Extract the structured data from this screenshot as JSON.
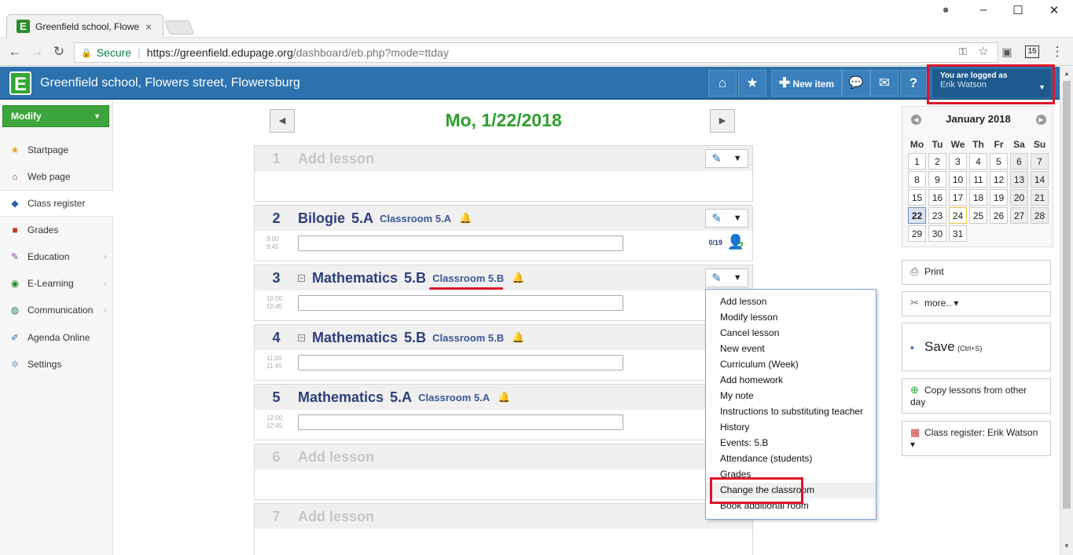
{
  "browser": {
    "tab_title": "Greenfield school, Flower",
    "tab_close": "×",
    "secure_label": "Secure",
    "url_main": "https://greenfield.edupage.org",
    "url_path": "/dashboard/eb.php?mode=ttday"
  },
  "header": {
    "school_name": "Greenfield school, Flowers street, Flowersburg",
    "new_item_label": "New item",
    "help_label": "?",
    "logged_as_label": "You are logged as",
    "user_name": "Erik Watson"
  },
  "sidebar": {
    "modify_label": "Modify",
    "items": [
      {
        "label": "Startpage"
      },
      {
        "label": "Web page"
      },
      {
        "label": "Class register"
      },
      {
        "label": "Grades"
      },
      {
        "label": "Education"
      },
      {
        "label": "E-Learning"
      },
      {
        "label": "Communication"
      },
      {
        "label": "Agenda Online"
      },
      {
        "label": "Settings"
      }
    ]
  },
  "day": {
    "title": "Mo, 1/22/2018"
  },
  "lessons": [
    {
      "num": "1",
      "subject": "Add lesson"
    },
    {
      "num": "2",
      "subject": "Bilogie",
      "class": "5.A",
      "room": "Classroom 5.A",
      "start": "9:00",
      "end": "9:45",
      "attendance": "0/19"
    },
    {
      "num": "3",
      "subject": "Mathematics",
      "class": "5.B",
      "room": "Classroom 5.B",
      "start": "10:00",
      "end": "10:45"
    },
    {
      "num": "4",
      "subject": "Mathematics",
      "class": "5.B",
      "room": "Classroom 5.B",
      "start": "11:00",
      "end": "11:45"
    },
    {
      "num": "5",
      "subject": "Mathematics",
      "class": "5.A",
      "room": "Classroom 5.A",
      "start": "12:00",
      "end": "12:45"
    },
    {
      "num": "6",
      "subject": "Add lesson"
    },
    {
      "num": "7",
      "subject": "Add lesson"
    }
  ],
  "menu": {
    "items": [
      "Add lesson",
      "Modify lesson",
      "Cancel lesson",
      "New event",
      "Curriculum (Week)",
      "Add homework",
      "My note",
      "Instructions to substituting teacher",
      "History",
      "Events: 5.B",
      "Attendance (students)",
      "Grades",
      "Change the classroom",
      "Book additional room"
    ]
  },
  "calendar": {
    "title": "January 2018",
    "weekdays": [
      "Mo",
      "Tu",
      "We",
      "Th",
      "Fr",
      "Sa",
      "Su"
    ],
    "weeks": [
      [
        "1",
        "2",
        "3",
        "4",
        "5",
        "6",
        "7"
      ],
      [
        "8",
        "9",
        "10",
        "11",
        "12",
        "13",
        "14"
      ],
      [
        "15",
        "16",
        "17",
        "18",
        "19",
        "20",
        "21"
      ],
      [
        "22",
        "23",
        "24",
        "25",
        "26",
        "27",
        "28"
      ],
      [
        "29",
        "30",
        "31",
        "",
        "",
        "",
        ""
      ]
    ]
  },
  "right": {
    "print_label": "Print",
    "more_label": "more.. ▾",
    "save_label": "Save",
    "save_shortcut": "(Ctrl+S)",
    "copy_label": "Copy lessons from other day",
    "register_label": "Class register: Erik Watson ▾"
  },
  "colors": {
    "accent_green": "#2ca02c",
    "header_blue": "#2b72ae",
    "highlight_red": "#e0142a"
  }
}
